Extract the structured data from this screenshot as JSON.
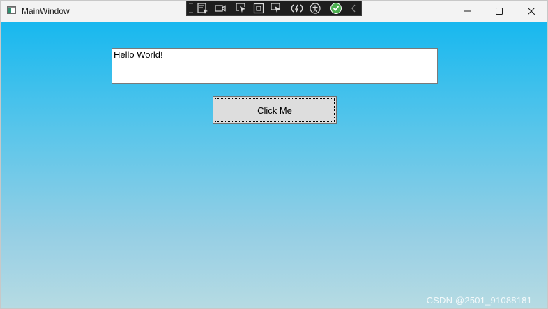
{
  "window": {
    "title": "MainWindow"
  },
  "debug_toolbar": {
    "icons": [
      "select-element-icon",
      "record-icon",
      "display-layout-adorners-icon",
      "track-focused-element-icon",
      "hot-reload-icon",
      "accessibility-icon",
      "binding-check-icon",
      "collapse-chevron-icon"
    ]
  },
  "main": {
    "textbox_value": "Hello World!",
    "button_label": "Click Me"
  },
  "watermark": {
    "text": "CSDN @2501_91088181"
  },
  "colors": {
    "gradient_top": "#17b8ef",
    "gradient_bottom": "#b6dbe3",
    "button_bg": "#dddddd",
    "titlebar_bg": "#f3f3f3",
    "check_green": "#4caf50"
  }
}
